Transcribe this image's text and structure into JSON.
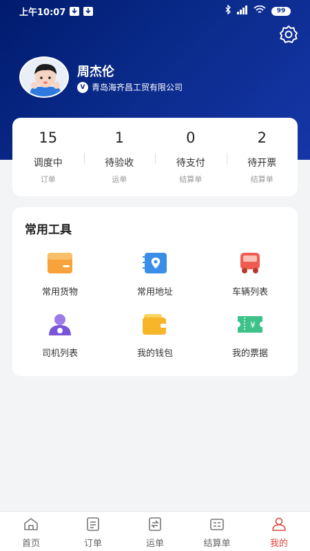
{
  "status_bar": {
    "time": "上午10:07",
    "battery": "99"
  },
  "profile": {
    "name": "周杰伦",
    "company": "青岛海齐昌工贸有限公司",
    "verified_mark": "V"
  },
  "stats": [
    {
      "value": "15",
      "label": "调度中",
      "sub": "订单"
    },
    {
      "value": "1",
      "label": "待验收",
      "sub": "运单"
    },
    {
      "value": "0",
      "label": "待支付",
      "sub": "结算单"
    },
    {
      "value": "2",
      "label": "待开票",
      "sub": "结算单"
    }
  ],
  "tools": {
    "title": "常用工具",
    "items": [
      {
        "label": "常用货物",
        "icon": "goods-box-icon"
      },
      {
        "label": "常用地址",
        "icon": "address-location-icon"
      },
      {
        "label": "车辆列表",
        "icon": "truck-icon"
      },
      {
        "label": "司机列表",
        "icon": "driver-icon"
      },
      {
        "label": "我的钱包",
        "icon": "wallet-icon"
      },
      {
        "label": "我的票据",
        "icon": "invoice-ticket-icon"
      }
    ]
  },
  "tabbar": {
    "items": [
      {
        "label": "首页",
        "icon": "home-icon"
      },
      {
        "label": "订单",
        "icon": "order-list-icon"
      },
      {
        "label": "运单",
        "icon": "waybill-icon"
      },
      {
        "label": "结算单",
        "icon": "settlement-icon"
      },
      {
        "label": "我的",
        "icon": "profile-icon",
        "active": true
      }
    ]
  },
  "colors": {
    "header_start": "#001b6e",
    "header_end": "#1636a8",
    "active_tab": "#e0453b",
    "background": "#f3f4f6"
  }
}
